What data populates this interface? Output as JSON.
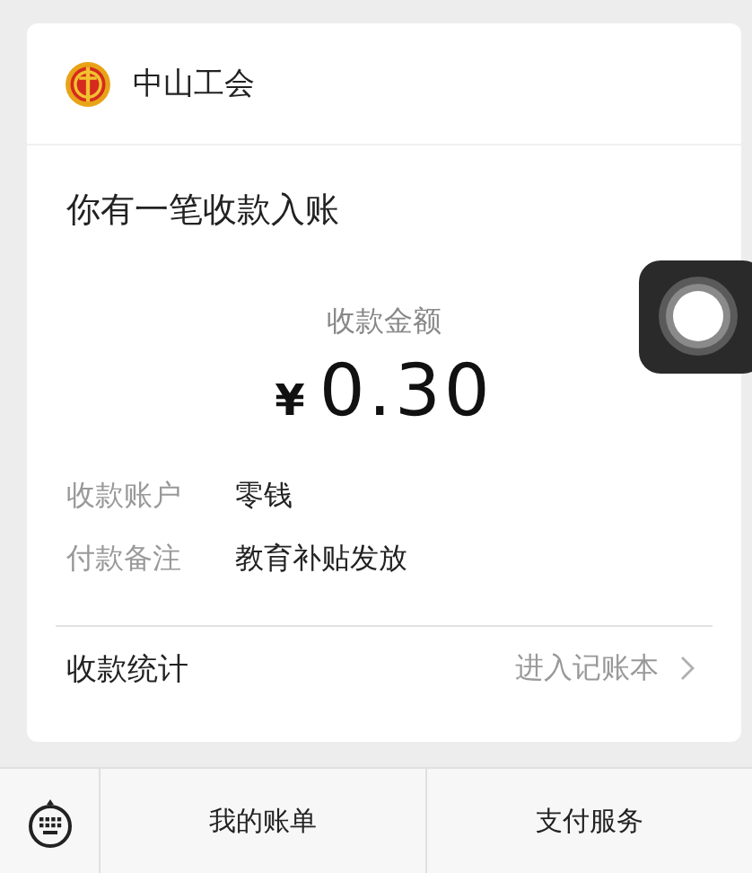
{
  "header": {
    "name": "中山工会"
  },
  "title": "你有一笔收款入账",
  "amount": {
    "label": "收款金额",
    "currency": "¥",
    "value": "0.30"
  },
  "details": [
    {
      "label": "收款账户",
      "value": "零钱"
    },
    {
      "label": "付款备注",
      "value": "教育补贴发放"
    }
  ],
  "stats": {
    "label": "收款统计",
    "link": "进入记账本"
  },
  "bottom_menu": [
    "我的账单",
    "支付服务"
  ]
}
